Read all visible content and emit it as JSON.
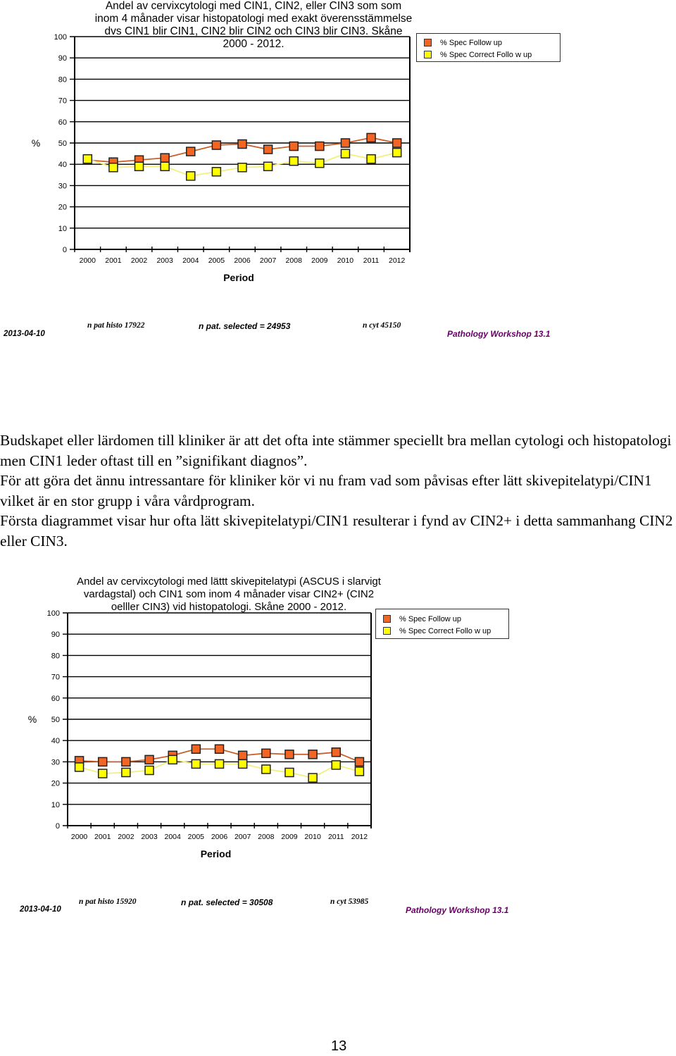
{
  "chart_data": [
    {
      "type": "line",
      "title": "Andel av cervixcytologi med CIN1, CIN2, eller CIN3 som som inom 4 månader visar histopatologi med exakt överensstämmelse dvs CIN1 blir CIN1, CIN2 blir CIN2 och CIN3 blir CIN3.  Skåne 2000 - 2012.",
      "title_lines": [
        "Andel av cervixcytologi med CIN1, CIN2, eller CIN3 som som",
        "inom 4 månader visar histopatologi med exakt överensstämmelse",
        "dvs CIN1 blir CIN1, CIN2 blir CIN2 och CIN3 blir CIN3.  Skåne",
        "2000 - 2012."
      ],
      "xlabel": "Period",
      "ylabel": "%",
      "ylim": [
        0,
        100
      ],
      "yticks": [
        0,
        10,
        20,
        30,
        40,
        50,
        60,
        70,
        80,
        90,
        100
      ],
      "grid": true,
      "legend_position": "top-right",
      "categories": [
        "2000",
        "2001",
        "2002",
        "2003",
        "2004",
        "2005",
        "2006",
        "2007",
        "2008",
        "2009",
        "2010",
        "2011",
        "2012"
      ],
      "series": [
        {
          "name": "% Spec Follow up",
          "color": "#f26522",
          "line_color": "#c8602a",
          "values": [
            42,
            41,
            42,
            43,
            46,
            49,
            49.5,
            47,
            48.5,
            48.5,
            50,
            52.5,
            50
          ]
        },
        {
          "name": "% Spec Correct Follo w up",
          "color": "#ffff00",
          "line_color": "#f2f07a",
          "values": [
            42.5,
            38.5,
            39,
            39,
            34.5,
            36.5,
            38.5,
            39,
            41.5,
            40.5,
            45,
            42.5,
            45.5
          ]
        }
      ],
      "footer": {
        "date": "2013-04-10",
        "n_pat_histo": "n pat histo 17922",
        "n_pat_selected": "n pat. selected =  24953",
        "n_cyt": "n cyt 45150",
        "workshop": "Pathology Workshop 13.1"
      }
    },
    {
      "type": "line",
      "title": "Andel av cervixcytologi med lättt skivepitelatypi (ASCUS i slarvigt vardagstal) och CIN1 som inom 4 månader visar CIN2+ (CIN2 oelller CIN3) vid histopatologi.  Skåne 2000 - 2012.",
      "title_lines": [
        "Andel av cervixcytologi med lättt skivepitelatypi (ASCUS i slarvigt",
        "vardagstal) och CIN1 som inom 4 månader visar CIN2+ (CIN2",
        "oelller CIN3) vid histopatologi.  Skåne 2000 - 2012."
      ],
      "xlabel": "Period",
      "ylabel": "%",
      "ylim": [
        0,
        100
      ],
      "yticks": [
        0,
        10,
        20,
        30,
        40,
        50,
        60,
        70,
        80,
        90,
        100
      ],
      "grid": true,
      "legend_position": "top-right",
      "categories": [
        "2000",
        "2001",
        "2002",
        "2003",
        "2004",
        "2005",
        "2006",
        "2007",
        "2008",
        "2009",
        "2010",
        "2011",
        "2012"
      ],
      "series": [
        {
          "name": "% Spec Follow up",
          "color": "#f26522",
          "line_color": "#c8602a",
          "values": [
            30.5,
            30,
            30,
            31,
            33,
            36,
            36,
            33,
            34,
            33.5,
            33.5,
            34.5,
            30
          ]
        },
        {
          "name": "% Spec Correct Follo w up",
          "color": "#ffff00",
          "line_color": "#f2f07a",
          "values": [
            27.5,
            24.5,
            25,
            26,
            31,
            29,
            29,
            29,
            26.5,
            25,
            22.5,
            28.5,
            25.5
          ]
        }
      ],
      "footer": {
        "date": "2013-04-10",
        "n_pat_histo": "n pat histo 15920",
        "n_pat_selected": "n pat. selected =  30508",
        "n_cyt": "n cyt 53985",
        "workshop": "Pathology Workshop 13.1"
      }
    }
  ],
  "body_text": [
    "Budskapet eller lärdomen till kliniker är att det ofta inte stämmer speciellt bra mellan cytologi och histopatologi men CIN1 leder oftast till en ”signifikant diagnos”.",
    "För att göra det ännu intressantare för kliniker kör vi nu fram vad som påvisas efter lätt skivepitelatypi/CIN1 vilket är en stor grupp i våra vårdprogram.",
    "Första diagrammet visar hur ofta lätt skivepitelatypi/CIN1 resulterar i fynd av CIN2+ i detta sammanhang CIN2 eller CIN3."
  ],
  "page_number": "13"
}
